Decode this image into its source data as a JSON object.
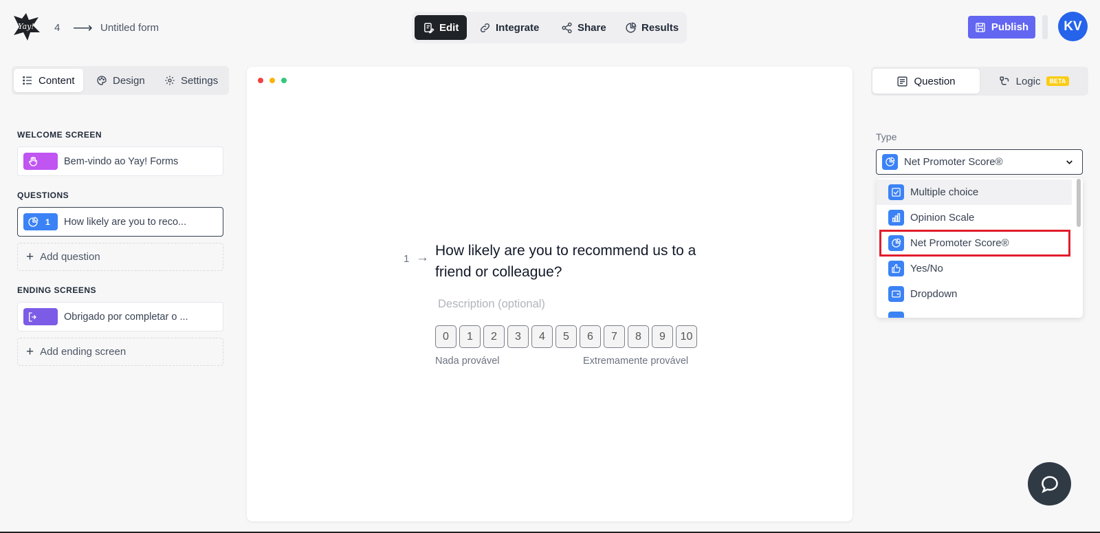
{
  "header": {
    "form_number": "4",
    "arrow": "⟶",
    "form_title": "Untitled form",
    "nav": [
      {
        "label": "Edit",
        "icon": "edit-icon",
        "active": true
      },
      {
        "label": "Integrate",
        "icon": "link-icon"
      },
      {
        "label": "Share",
        "icon": "share-icon"
      },
      {
        "label": "Results",
        "icon": "chart-icon"
      }
    ],
    "publish_label": "Publish",
    "avatar_initials": "KV"
  },
  "left_panel": {
    "tabs": [
      {
        "label": "Content",
        "icon": "list-icon",
        "active": true
      },
      {
        "label": "Design",
        "icon": "palette-icon"
      },
      {
        "label": "Settings",
        "icon": "gear-icon"
      }
    ],
    "welcome_label": "WELCOME SCREEN",
    "welcome_item": {
      "text": "Bem-vindo ao Yay! Forms",
      "color": "#c055f2"
    },
    "questions_label": "QUESTIONS",
    "question_item": {
      "number": "1",
      "text": "How likely are you to reco...",
      "color": "#3b82f6"
    },
    "add_question": "Add question",
    "ending_label": "ENDING SCREENS",
    "ending_item": {
      "text": "Obrigado por completar o ...",
      "color": "#7c5ce6"
    },
    "add_ending": "Add ending screen"
  },
  "preview": {
    "question_number": "1",
    "arrow": "→",
    "question_title": "How likely are you to recommend us to a friend or colleague?",
    "description_placeholder": "Description (optional)",
    "scale": [
      "0",
      "1",
      "2",
      "3",
      "4",
      "5",
      "6",
      "7",
      "8",
      "9",
      "10"
    ],
    "low_label": "Nada provável",
    "high_label": "Extremamente provável"
  },
  "right_panel": {
    "tabs": [
      {
        "label": "Question",
        "icon": "sliders-icon",
        "active": true
      },
      {
        "label": "Logic",
        "icon": "logic-icon",
        "badge": "BETA"
      }
    ],
    "type_label": "Type",
    "type_value": "Net Promoter Score®",
    "options": [
      {
        "label": "Multiple choice",
        "icon": "checkbox-icon"
      },
      {
        "label": "Opinion Scale",
        "icon": "bars-icon"
      },
      {
        "label": "Net Promoter Score®",
        "icon": "nps-icon",
        "highlighted": true
      },
      {
        "label": "Yes/No",
        "icon": "thumbs-up-icon"
      },
      {
        "label": "Dropdown",
        "icon": "dropdown-icon"
      }
    ]
  },
  "colors": {
    "accent_publish": "#6366f1",
    "avatar": "#2563eb",
    "highlight_red": "#e11d2c",
    "type_icon_blue": "#3b82f6"
  }
}
